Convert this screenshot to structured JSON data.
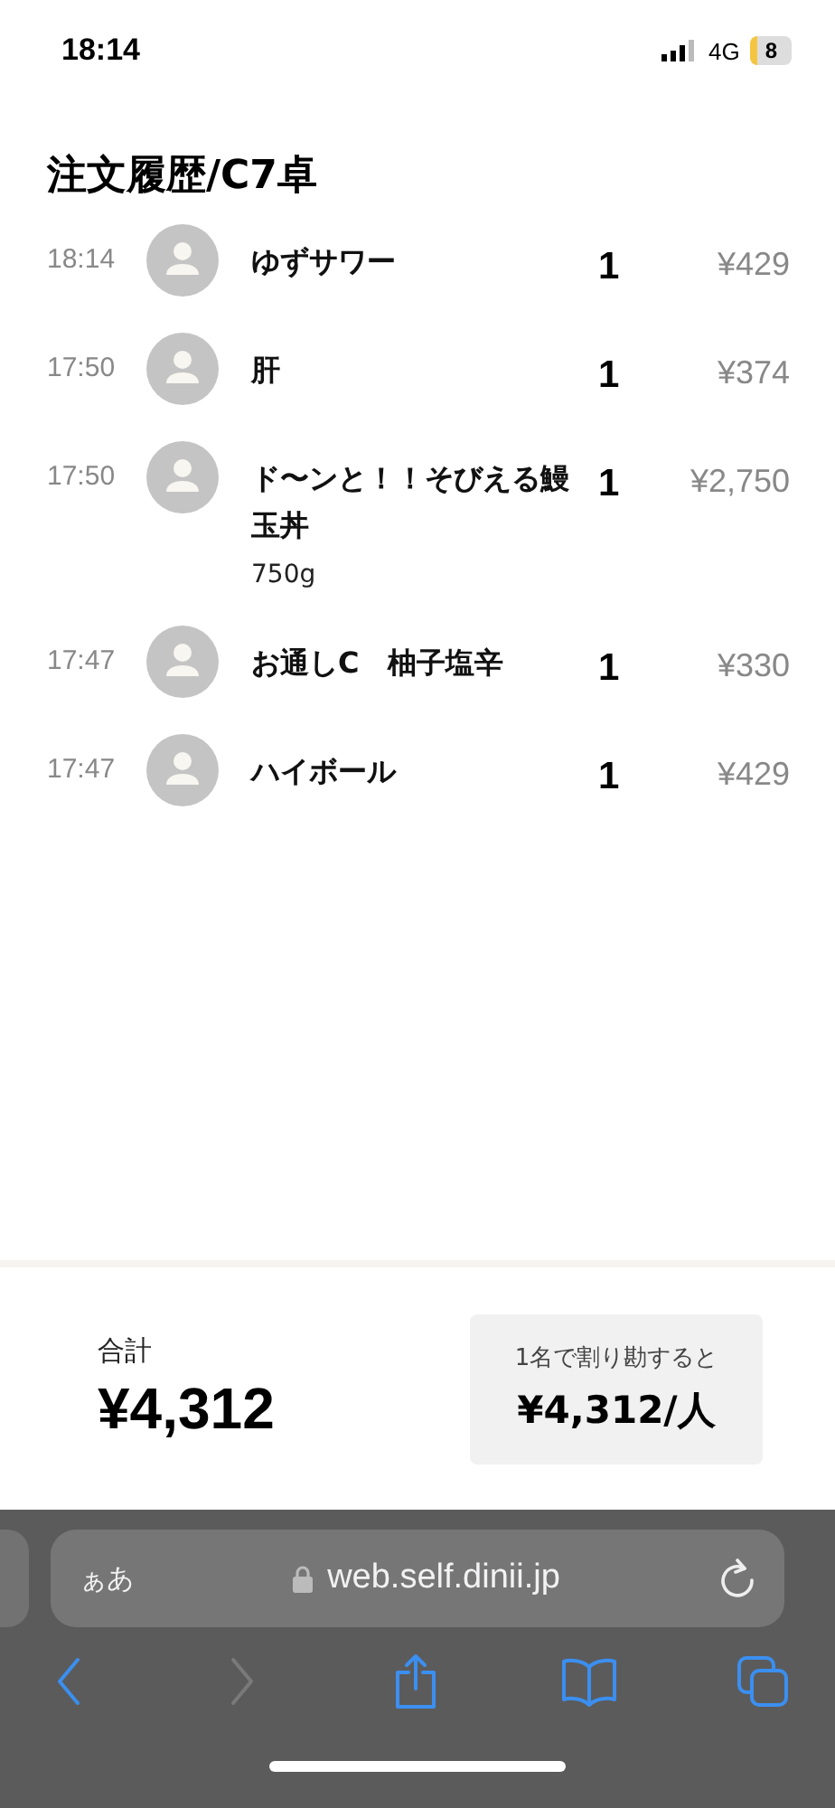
{
  "status_bar": {
    "time": "18:14",
    "network": "4G",
    "battery": "8"
  },
  "title": "注文履歴/C7卓",
  "orders": [
    {
      "time": "18:14",
      "name": "ゆずサワー",
      "quantity": "1",
      "price": "¥429"
    },
    {
      "time": "17:50",
      "name": "肝",
      "quantity": "1",
      "price": "¥374"
    },
    {
      "time": "17:50",
      "name": "ド〜ンと！！そびえる鰻玉丼",
      "option": "750g",
      "quantity": "1",
      "price": "¥2,750"
    },
    {
      "time": "17:47",
      "name": "お通しC　柚子塩辛",
      "quantity": "1",
      "price": "¥330"
    },
    {
      "time": "17:47",
      "name": "ハイボール",
      "quantity": "1",
      "price": "¥429"
    }
  ],
  "summary": {
    "total_label": "合計",
    "total": "¥4,312",
    "split_label": "1名で割り勘すると",
    "split_amount": "¥4,312/人"
  },
  "browser": {
    "text_size": "ぁあ",
    "url": "web.self.dinii.jp",
    "toolbar": [
      {
        "kind": "back",
        "disabled": false
      },
      {
        "kind": "forward",
        "disabled": true
      },
      {
        "kind": "share",
        "disabled": false
      },
      {
        "kind": "bookmarks",
        "disabled": false
      },
      {
        "kind": "tabs",
        "disabled": false
      }
    ]
  }
}
